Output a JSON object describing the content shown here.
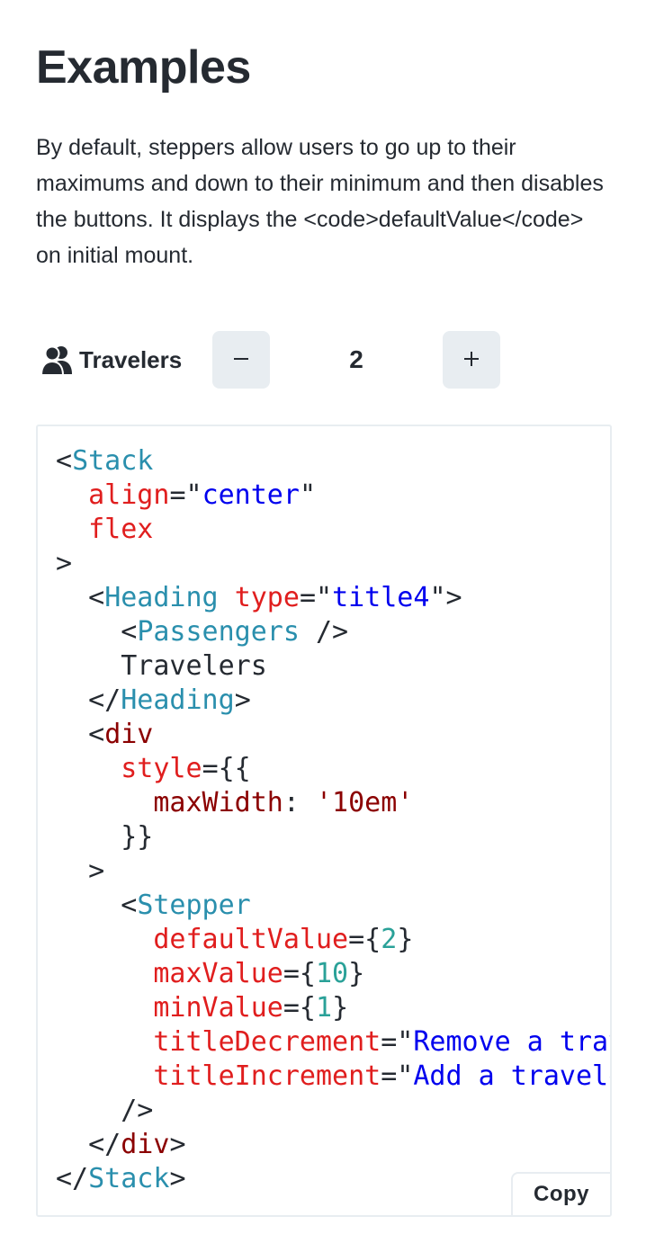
{
  "section": {
    "title": "Examples",
    "description": "By default, steppers allow users to go up to their maximums and down to their minimum and then disables the buttons. It displays the <code>defaultValue</code> on initial mount."
  },
  "demo": {
    "heading_label": "Travelers",
    "heading_icon": "passengers-icon",
    "stepper": {
      "decrement_symbol": "−",
      "increment_symbol": "+",
      "value": "2",
      "title_decrement": "Remove a traveler",
      "title_increment": "Add a traveler"
    }
  },
  "code": {
    "lines": [
      [
        {
          "t": "<",
          "c": "plain"
        },
        {
          "t": "Stack",
          "c": "tag"
        }
      ],
      [
        {
          "t": "  ",
          "c": "plain"
        },
        {
          "t": "align",
          "c": "attr"
        },
        {
          "t": "=\"",
          "c": "plain"
        },
        {
          "t": "center",
          "c": "str"
        },
        {
          "t": "\"",
          "c": "plain"
        }
      ],
      [
        {
          "t": "  ",
          "c": "plain"
        },
        {
          "t": "flex",
          "c": "attr"
        }
      ],
      [
        {
          "t": ">",
          "c": "plain"
        }
      ],
      [
        {
          "t": "  <",
          "c": "plain"
        },
        {
          "t": "Heading",
          "c": "tag"
        },
        {
          "t": " ",
          "c": "plain"
        },
        {
          "t": "type",
          "c": "attr"
        },
        {
          "t": "=\"",
          "c": "plain"
        },
        {
          "t": "title4",
          "c": "str"
        },
        {
          "t": "\">",
          "c": "plain"
        }
      ],
      [
        {
          "t": "    <",
          "c": "plain"
        },
        {
          "t": "Passengers",
          "c": "tag"
        },
        {
          "t": " />",
          "c": "plain"
        }
      ],
      [
        {
          "t": "    Travelers",
          "c": "plain"
        }
      ],
      [
        {
          "t": "  </",
          "c": "plain"
        },
        {
          "t": "Heading",
          "c": "tag"
        },
        {
          "t": ">",
          "c": "plain"
        }
      ],
      [
        {
          "t": "  <",
          "c": "plain"
        },
        {
          "t": "div",
          "c": "el"
        }
      ],
      [
        {
          "t": "    ",
          "c": "plain"
        },
        {
          "t": "style",
          "c": "attr"
        },
        {
          "t": "={{",
          "c": "plain"
        }
      ],
      [
        {
          "t": "      ",
          "c": "plain"
        },
        {
          "t": "maxWidth",
          "c": "el"
        },
        {
          "t": ": ",
          "c": "plain"
        },
        {
          "t": "'10em'",
          "c": "el"
        }
      ],
      [
        {
          "t": "    }}",
          "c": "plain"
        }
      ],
      [
        {
          "t": "  >",
          "c": "plain"
        }
      ],
      [
        {
          "t": "    <",
          "c": "plain"
        },
        {
          "t": "Stepper",
          "c": "tag"
        }
      ],
      [
        {
          "t": "      ",
          "c": "plain"
        },
        {
          "t": "defaultValue",
          "c": "attr"
        },
        {
          "t": "={",
          "c": "plain"
        },
        {
          "t": "2",
          "c": "num"
        },
        {
          "t": "}",
          "c": "plain"
        }
      ],
      [
        {
          "t": "      ",
          "c": "plain"
        },
        {
          "t": "maxValue",
          "c": "attr"
        },
        {
          "t": "={",
          "c": "plain"
        },
        {
          "t": "10",
          "c": "num"
        },
        {
          "t": "}",
          "c": "plain"
        }
      ],
      [
        {
          "t": "      ",
          "c": "plain"
        },
        {
          "t": "minValue",
          "c": "attr"
        },
        {
          "t": "={",
          "c": "plain"
        },
        {
          "t": "1",
          "c": "num"
        },
        {
          "t": "}",
          "c": "plain"
        }
      ],
      [
        {
          "t": "      ",
          "c": "plain"
        },
        {
          "t": "titleDecrement",
          "c": "attr"
        },
        {
          "t": "=\"",
          "c": "plain"
        },
        {
          "t": "Remove a traveler",
          "c": "str"
        },
        {
          "t": "\"",
          "c": "plain"
        }
      ],
      [
        {
          "t": "      ",
          "c": "plain"
        },
        {
          "t": "titleIncrement",
          "c": "attr"
        },
        {
          "t": "=\"",
          "c": "plain"
        },
        {
          "t": "Add a traveler",
          "c": "str"
        },
        {
          "t": "\"",
          "c": "plain"
        }
      ],
      [
        {
          "t": "    />",
          "c": "plain"
        }
      ],
      [
        {
          "t": "  </",
          "c": "plain"
        },
        {
          "t": "div",
          "c": "el"
        },
        {
          "t": ">",
          "c": "plain"
        }
      ],
      [
        {
          "t": "</",
          "c": "plain"
        },
        {
          "t": "Stack",
          "c": "tag"
        },
        {
          "t": ">",
          "c": "plain"
        }
      ]
    ],
    "copy_label": "Copy"
  },
  "colors": {
    "text": "#252a31",
    "button_bg": "#e8edf1",
    "border": "#e8edf1",
    "code_tag": "#2a8fad",
    "code_attr": "#e01e1e",
    "code_string": "#0000ee",
    "code_number": "#2aa198",
    "code_element": "#8b0000"
  }
}
